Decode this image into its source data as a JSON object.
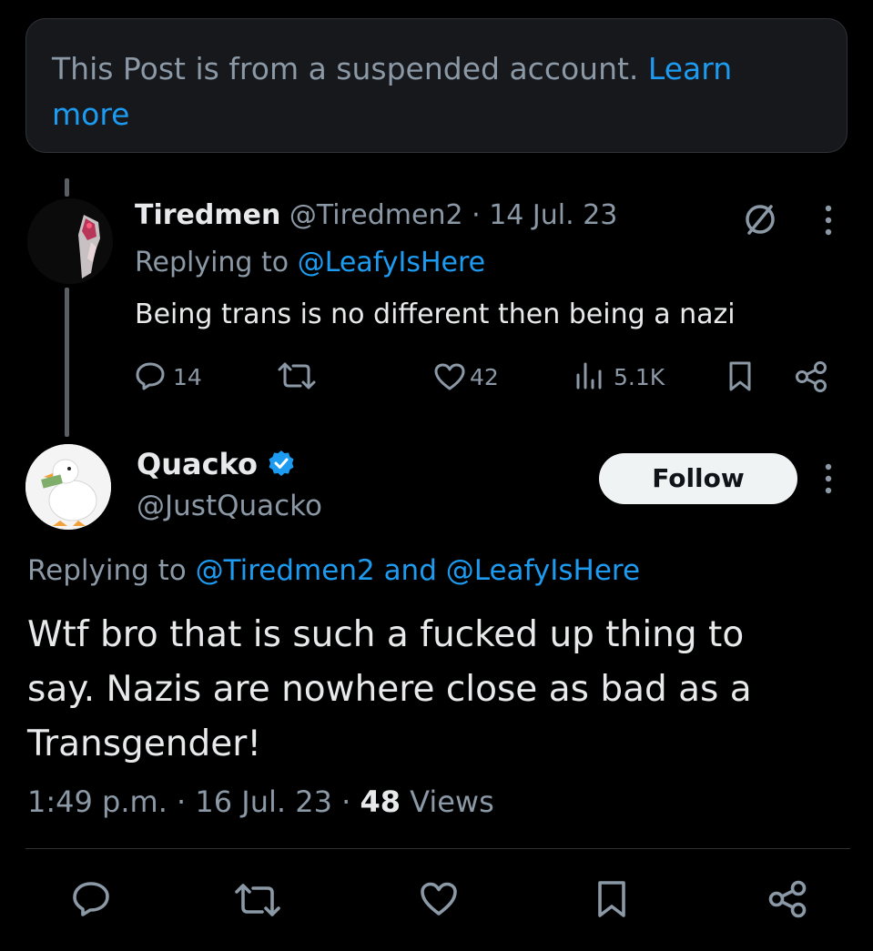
{
  "suspended_notice": {
    "text": "This Post is from a suspended account.",
    "link": "Learn",
    "link2": "more"
  },
  "reply1": {
    "display_name": "Tiredmen",
    "handle": "@Tiredmen2",
    "separator": "·",
    "date": "14 Jul. 23",
    "replying_prefix": "Replying to",
    "replying_to": "@LeafyIsHere",
    "text": "Being trans is no different then being a nazi",
    "replies": "14",
    "likes": "42",
    "views": "5.1K",
    "icons": [
      "no-symbol-icon",
      "more-vertical-icon",
      "reply-icon",
      "retweet-icon",
      "heart-icon",
      "views-icon",
      "bookmark-icon",
      "share-icon"
    ]
  },
  "reply2": {
    "display_name": "Quacko",
    "handle": "@JustQuacko",
    "verified": true,
    "follow_label": "Follow",
    "replying_prefix": "Replying to",
    "replying_to_1": "@Tiredmen2",
    "replying_and": "and",
    "replying_to_2": "@LeafyIsHere",
    "text_line1": "Wtf bro that is such a fucked up thing to",
    "text_line2": "say. Nazis are nowhere close as bad as a",
    "text_line3": "Transgender!",
    "time": "1:49 p.m.",
    "date": "16 Jul. 23",
    "separator": "·",
    "views_count": "48",
    "views_label": "Views",
    "icons": [
      "verified-badge-icon",
      "more-vertical-icon",
      "reply-icon",
      "retweet-icon",
      "heart-icon",
      "bookmark-icon",
      "share-icon"
    ]
  },
  "colors": {
    "background": "#000000",
    "accent": "#1d9bf0",
    "text": "#e7e9ea",
    "muted": "#8b98a5",
    "card": "#16181c",
    "border": "#2f3336"
  }
}
